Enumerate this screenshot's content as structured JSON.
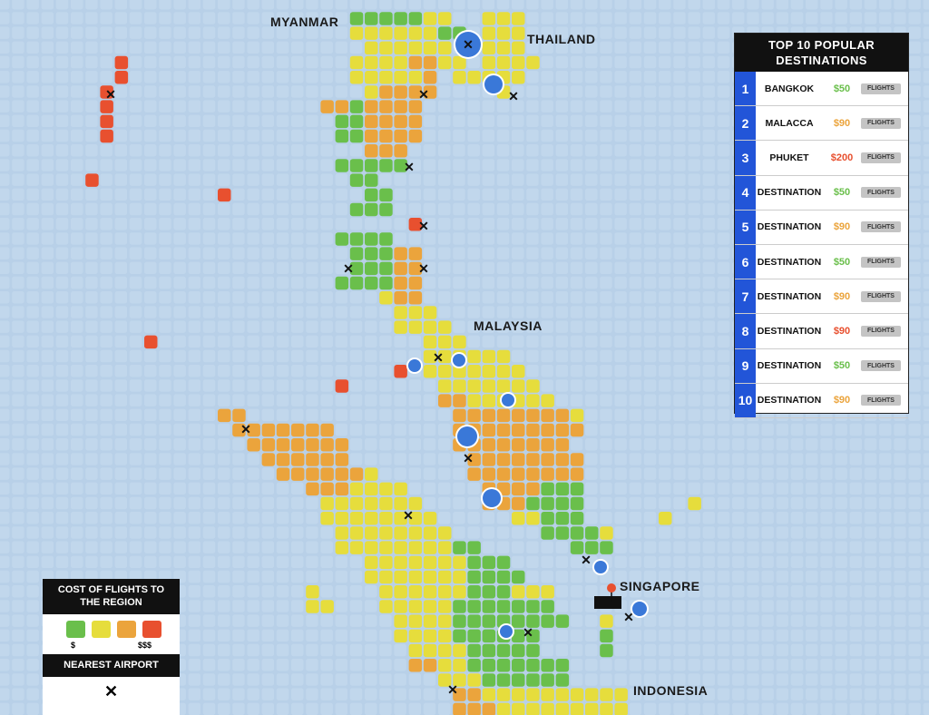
{
  "map": {
    "region_labels": {
      "myanmar": "MYANMAR",
      "thailand": "THAILAND",
      "malaysia": "MALAYSIA",
      "singapore": "SINGAPORE",
      "indonesia": "INDONESIA"
    },
    "colors": {
      "sea": "#b8d0e8",
      "green": "#6abf4b",
      "yellow": "#e6dd3c",
      "orange": "#eba43c",
      "red": "#e8502f",
      "pin": "#3a78d8",
      "airport_marker": "#111111",
      "sg_pin": "#e8502f"
    }
  },
  "top10": {
    "title": "TOP 10 POPULAR DESTINATIONS",
    "flights_label": "FLIGHTS",
    "rows": [
      {
        "rank": "1",
        "name": "BANGKOK",
        "price": "$50",
        "tier": "green"
      },
      {
        "rank": "2",
        "name": "MALACCA",
        "price": "$90",
        "tier": "orange"
      },
      {
        "rank": "3",
        "name": "PHUKET",
        "price": "$200",
        "tier": "red"
      },
      {
        "rank": "4",
        "name": "DESTINATION",
        "price": "$50",
        "tier": "green"
      },
      {
        "rank": "5",
        "name": "DESTINATION",
        "price": "$90",
        "tier": "orange"
      },
      {
        "rank": "6",
        "name": "DESTINATION",
        "price": "$50",
        "tier": "green"
      },
      {
        "rank": "7",
        "name": "DESTINATION",
        "price": "$90",
        "tier": "orange"
      },
      {
        "rank": "8",
        "name": "DESTINATION",
        "price": "$90",
        "tier": "red"
      },
      {
        "rank": "9",
        "name": "DESTINATION",
        "price": "$50",
        "tier": "green"
      },
      {
        "rank": "10",
        "name": "DESTINATION",
        "price": "$90",
        "tier": "orange"
      }
    ],
    "price_colors": {
      "green": "#6abf4b",
      "orange": "#eba43c",
      "red": "#e8502f"
    }
  },
  "legend": {
    "cost_title": "COST OF FLIGHTS TO THE REGION",
    "low_label": "$",
    "high_label": "$$$",
    "airport_title": "NEAREST AIRPORT",
    "airport_symbol": "✕",
    "swatches": [
      "#6abf4b",
      "#e6dd3c",
      "#eba43c",
      "#e8502f"
    ]
  }
}
